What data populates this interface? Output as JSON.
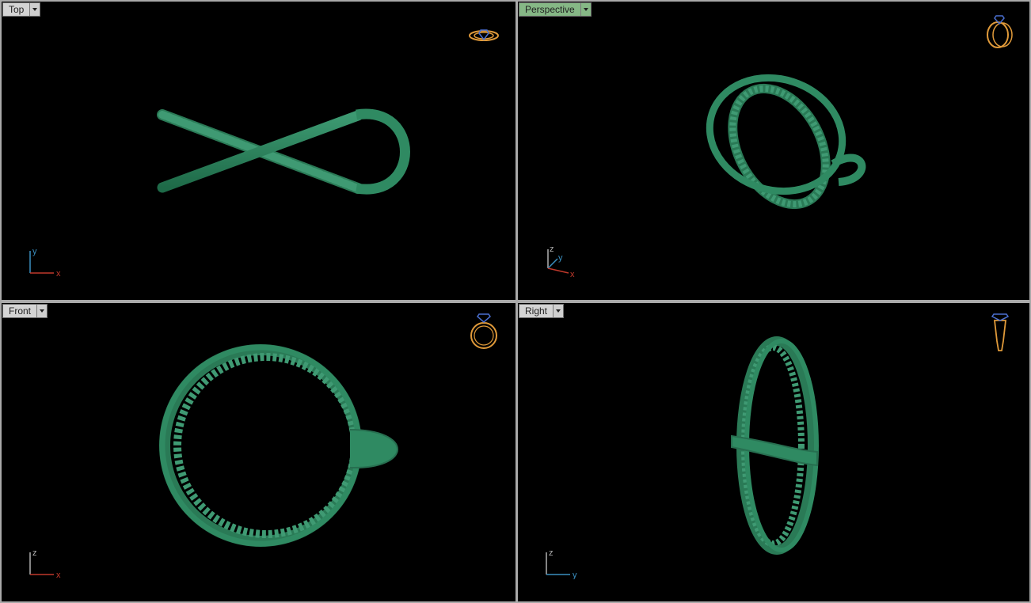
{
  "viewports": {
    "top": {
      "label": "Top",
      "axes": {
        "a": "y",
        "b": "x"
      }
    },
    "perspective": {
      "label": "Perspective",
      "axes": {
        "z": "z",
        "y": "y",
        "x": "x"
      }
    },
    "front": {
      "label": "Front",
      "axes": {
        "a": "z",
        "b": "x"
      }
    },
    "right": {
      "label": "Right",
      "axes": {
        "a": "z",
        "b": "y"
      }
    }
  },
  "active_viewport": "Perspective",
  "colors": {
    "model": "#2f8a62",
    "background": "#000000",
    "x_axis": "#c0392b",
    "y_axis": "#3a8fc0",
    "z_axis": "#b0b0b0",
    "widget_ring": "#e09a3a",
    "widget_gem": "#4a6fd0",
    "active_tab": "#86b886"
  },
  "icons": [
    "ring-navigation-widget-icon",
    "dropdown-arrow-icon",
    "axis-indicator-icon"
  ]
}
